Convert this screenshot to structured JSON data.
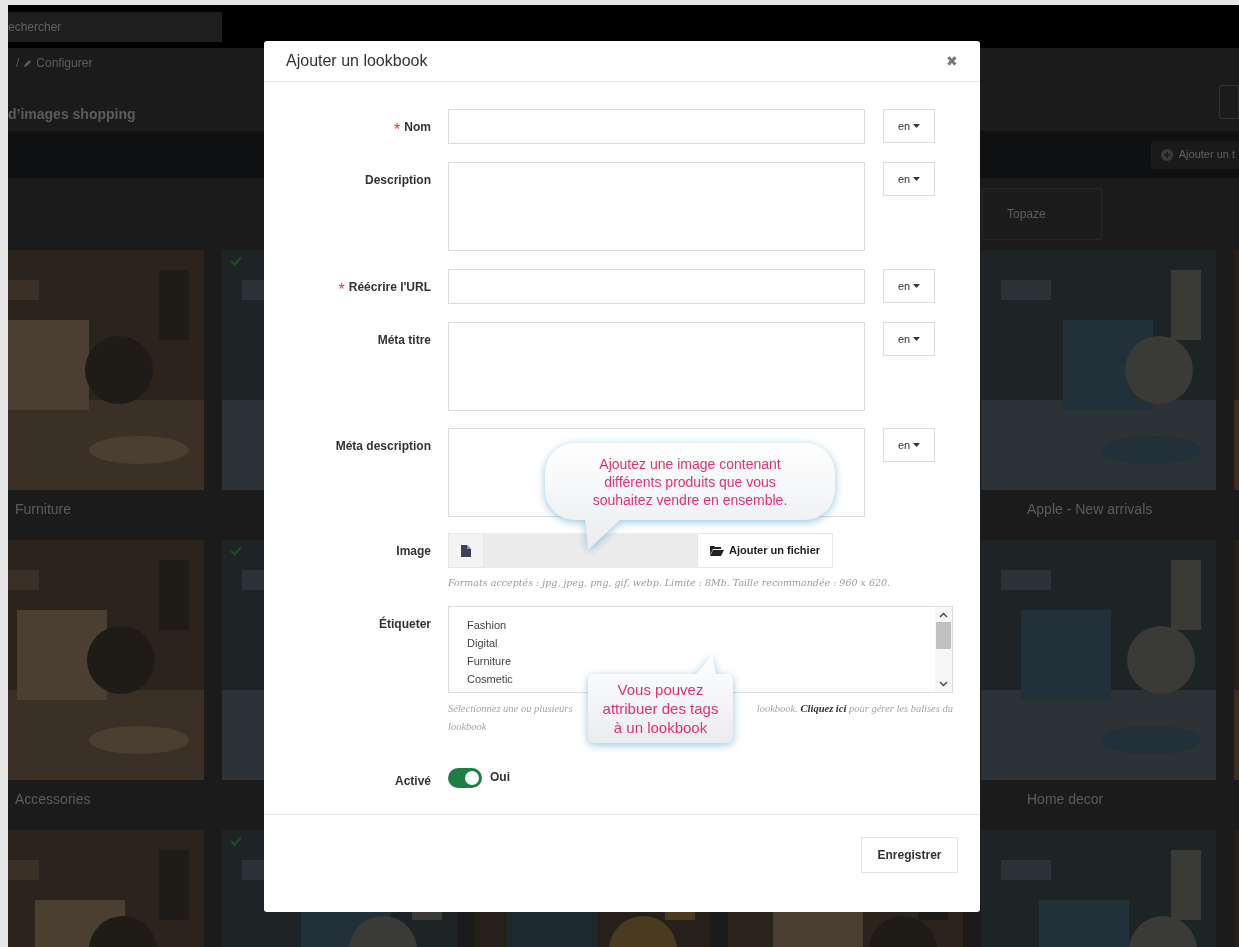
{
  "background": {
    "search_placeholder": "echercher",
    "breadcrumb_separator": "/",
    "breadcrumb": "Configurer",
    "page_title": "d’images shopping",
    "add_button": "Ajouter un t",
    "tab": "Topaze",
    "card_rows": [
      [
        {
          "kind": "picture",
          "label": "Furniture"
        },
        {
          "kind": "picture",
          "checked": true
        },
        {
          "kind": "hidden"
        },
        {
          "kind": "hidden"
        },
        {
          "kind": "picture",
          "label": "Apple - New arrivals"
        },
        {
          "kind": "picture"
        }
      ],
      [
        {
          "kind": "picture",
          "label": "Accessories"
        },
        {
          "kind": "picture",
          "checked": true
        },
        {
          "kind": "hidden"
        },
        {
          "kind": "hidden"
        },
        {
          "kind": "picture",
          "label": "Home decor"
        },
        {
          "kind": "picture"
        }
      ],
      [
        {
          "kind": "picture"
        },
        {
          "kind": "picture",
          "checked": true
        },
        {
          "kind": "picture"
        },
        {
          "kind": "picture"
        },
        {
          "kind": "picture"
        },
        {
          "kind": "picture"
        }
      ]
    ]
  },
  "modal": {
    "title": "Ajouter un lookbook",
    "close": "✖",
    "required_mark": "*",
    "fields": [
      {
        "kind": "text",
        "label": "Nom",
        "required": true,
        "lang": "en"
      },
      {
        "kind": "textarea",
        "label": "Description",
        "required": false,
        "lang": "en"
      },
      {
        "kind": "text",
        "label": "Réécrire l'URL",
        "required": true,
        "lang": "en"
      },
      {
        "kind": "textarea",
        "label": "Méta titre",
        "required": false,
        "lang": "en"
      },
      {
        "kind": "textarea",
        "label": "Méta description",
        "required": false,
        "lang": "en"
      }
    ],
    "image": {
      "label": "Image",
      "button": "Ajouter un fichier",
      "help": "Formats acceptés : jpg, jpeg, png, gif, webp. Limite : 8Mb. Taille recommandée : 960 x 620."
    },
    "tags": {
      "label": "Étiqueter",
      "options": [
        "Fashion",
        "Digital",
        "Furniture",
        "Cosmetic"
      ],
      "help_start": "Sélectionnez une ou plusieurs",
      "help_middle": "lookbook. **Cliquez ici** pour gérer les balises du",
      "help_end": "lookbook"
    },
    "active": {
      "label": "Activé",
      "on": true,
      "text": "Oui"
    },
    "save": "Enregistrer",
    "callouts": [
      {
        "text": "Ajoutez une image contenant différents produits que vous souhaitez vendre en ensemble."
      },
      {
        "text": "Vous pouvez attribuer des tags à un lookbook"
      }
    ]
  }
}
